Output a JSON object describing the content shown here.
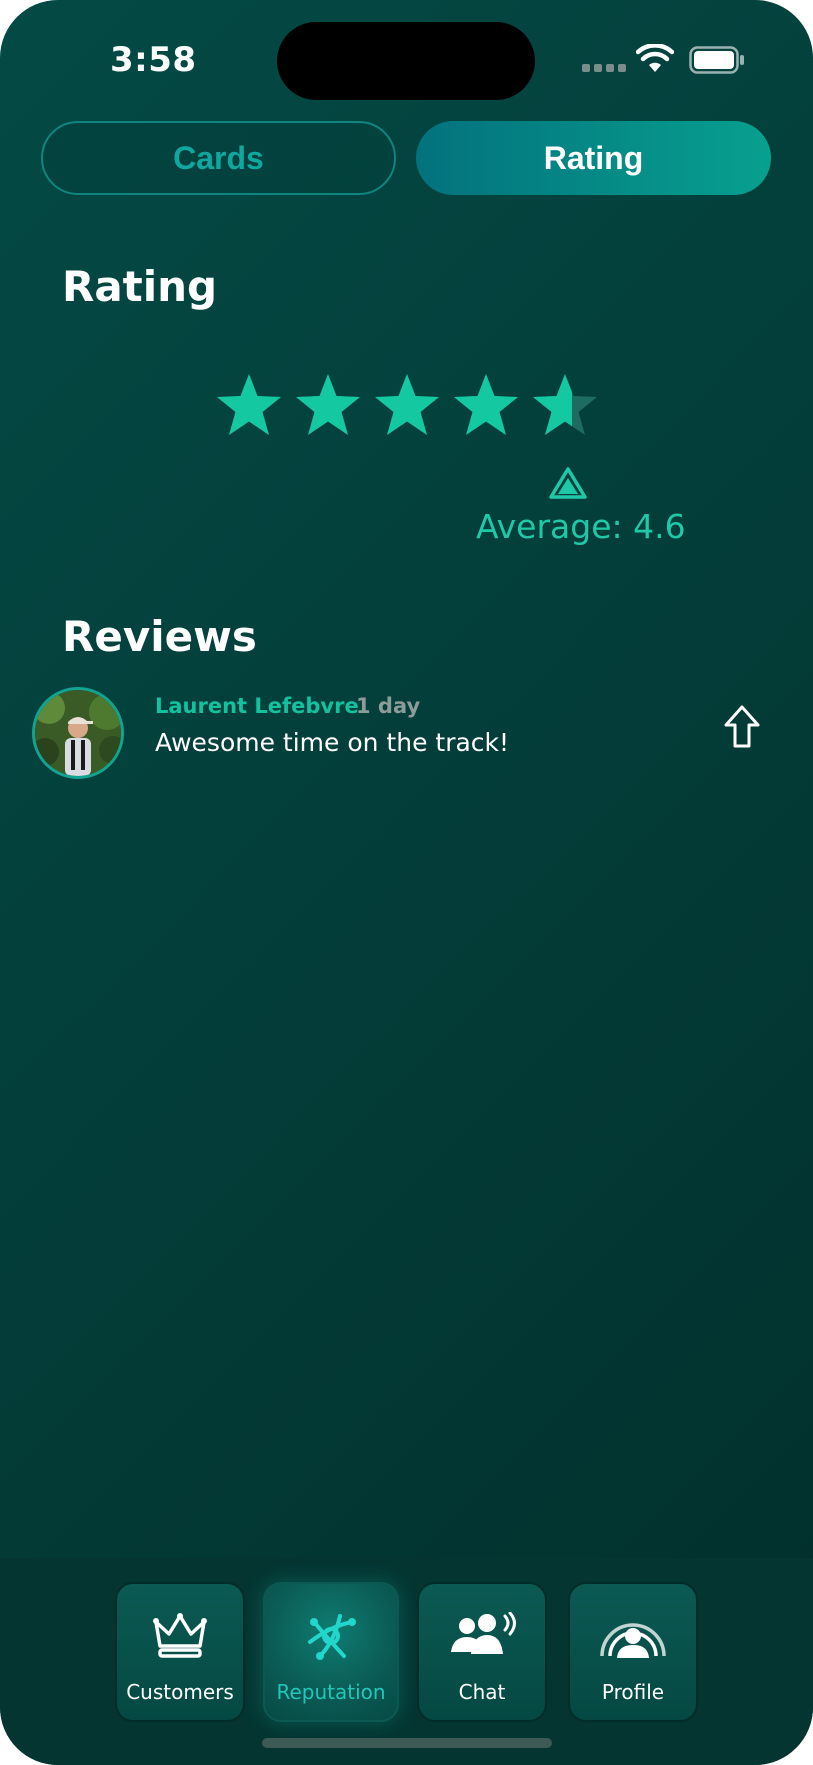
{
  "status_bar": {
    "time": "3:58"
  },
  "segmented": {
    "cards_label": "Cards",
    "rating_label": "Rating",
    "selected": "Rating"
  },
  "rating": {
    "heading": "Rating",
    "star_value": 4.6,
    "max_stars": 5,
    "average_text": "Average: 4.6",
    "star_color": "#14c9a1",
    "star_empty_color": "#1e6b62"
  },
  "reviews": {
    "heading": "Reviews",
    "items": [
      {
        "author": "Laurent Lefebvre",
        "age": "1 day",
        "text": "Awesome time on the track!",
        "share_icon": "share-up-arrow-icon"
      }
    ]
  },
  "tabbar": {
    "items": [
      {
        "label": "Customers",
        "icon": "crown-icon",
        "active": false
      },
      {
        "label": "Reputation",
        "icon": "reputation-icon",
        "active": true
      },
      {
        "label": "Chat",
        "icon": "chat-people-icon",
        "active": false
      },
      {
        "label": "Profile",
        "icon": "profile-arch-icon",
        "active": false
      }
    ]
  },
  "colors": {
    "accent": "#14c9a1",
    "background": "#033e3a",
    "tab_active_label": "#23c6bb"
  }
}
